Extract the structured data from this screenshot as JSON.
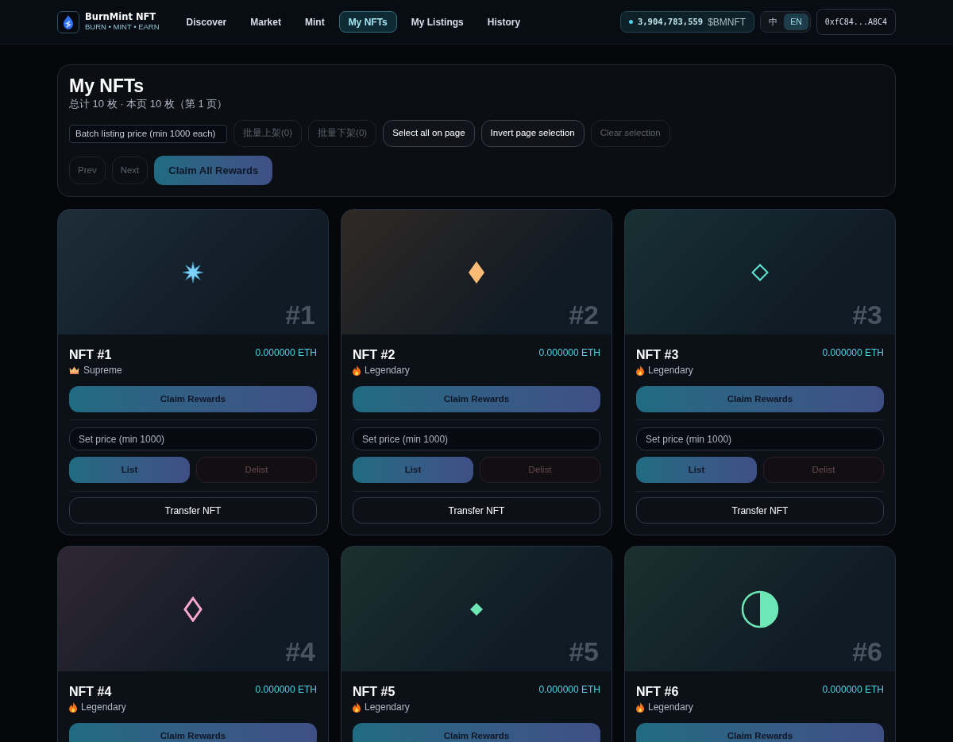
{
  "brand": {
    "name": "BurnMint NFT",
    "tagline": "BURN • MINT • EARN"
  },
  "nav": [
    {
      "label": "Discover",
      "selected": false
    },
    {
      "label": "Market",
      "selected": false
    },
    {
      "label": "Mint",
      "selected": false
    },
    {
      "label": "My NFTs",
      "selected": true
    },
    {
      "label": "My Listings",
      "selected": false
    },
    {
      "label": "History",
      "selected": false
    }
  ],
  "balance": {
    "amount": "3,904,783,559",
    "symbol": "$BMNFT"
  },
  "languages": [
    {
      "label": "中",
      "selected": false
    },
    {
      "label": "EN",
      "selected": true
    }
  ],
  "wallet": "0xfC84...A8C4",
  "panel": {
    "title": "My NFTs",
    "subtitle": "总计 10 枚 · 本页 10 枚（第 1 页）",
    "batch_price_placeholder": "Batch listing price (min 1000 each)",
    "actions": [
      {
        "label": "批量上架(0)",
        "disabled": true
      },
      {
        "label": "批量下架(0)",
        "disabled": true
      },
      {
        "label": "Select all on page",
        "disabled": false
      },
      {
        "label": "Invert page selection",
        "disabled": false
      },
      {
        "label": "Clear selection",
        "disabled": true
      }
    ],
    "pager": [
      {
        "label": "Prev",
        "disabled": true
      },
      {
        "label": "Next",
        "disabled": true
      }
    ],
    "claim_all": "Claim All Rewards"
  },
  "nfts": [
    {
      "name": "NFT #1",
      "number": "#1",
      "price": "0.000000 ETH",
      "rarity": "Supreme",
      "kind": "supreme",
      "art": {
        "kind": "star",
        "color": "#7dd3fc"
      },
      "claim": "Claim Rewards",
      "price_placeholder": "Set price (min 1000)",
      "list": "List",
      "delist": "Delist",
      "delist_disabled": true,
      "transfer": "Transfer NFT"
    },
    {
      "name": "NFT #2",
      "number": "#2",
      "price": "0.000000 ETH",
      "rarity": "Legendary",
      "kind": "legendary",
      "art": {
        "kind": "diamond",
        "color": "#fdba74"
      },
      "claim": "Claim Rewards",
      "price_placeholder": "Set price (min 1000)",
      "list": "List",
      "delist": "Delist",
      "delist_disabled": true,
      "transfer": "Transfer NFT"
    },
    {
      "name": "NFT #3",
      "number": "#3",
      "price": "0.000000 ETH",
      "rarity": "Legendary",
      "kind": "legendary",
      "art": {
        "kind": "diamond-outline",
        "color": "#5eead4"
      },
      "claim": "Claim Rewards",
      "price_placeholder": "Set price (min 1000)",
      "list": "List",
      "delist": "Delist",
      "delist_disabled": true,
      "transfer": "Transfer NFT"
    },
    {
      "name": "NFT #4",
      "number": "#4",
      "price": "0.000000 ETH",
      "rarity": "Legendary",
      "kind": "legendary",
      "art": {
        "kind": "tall-diamond-outline",
        "color": "#f9a8d4"
      },
      "claim": "Claim Rewards"
    },
    {
      "name": "NFT #5",
      "number": "#5",
      "price": "0.000000 ETH",
      "rarity": "Legendary",
      "kind": "legendary",
      "art": {
        "kind": "small-diamond",
        "color": "#6ee7b7"
      },
      "claim": "Claim Rewards"
    },
    {
      "name": "NFT #6",
      "number": "#6",
      "price": "0.000000 ETH",
      "rarity": "Legendary",
      "kind": "legendary",
      "art": {
        "kind": "half-circle",
        "color": "#6ee7b7"
      },
      "claim": "Claim Rewards"
    }
  ]
}
